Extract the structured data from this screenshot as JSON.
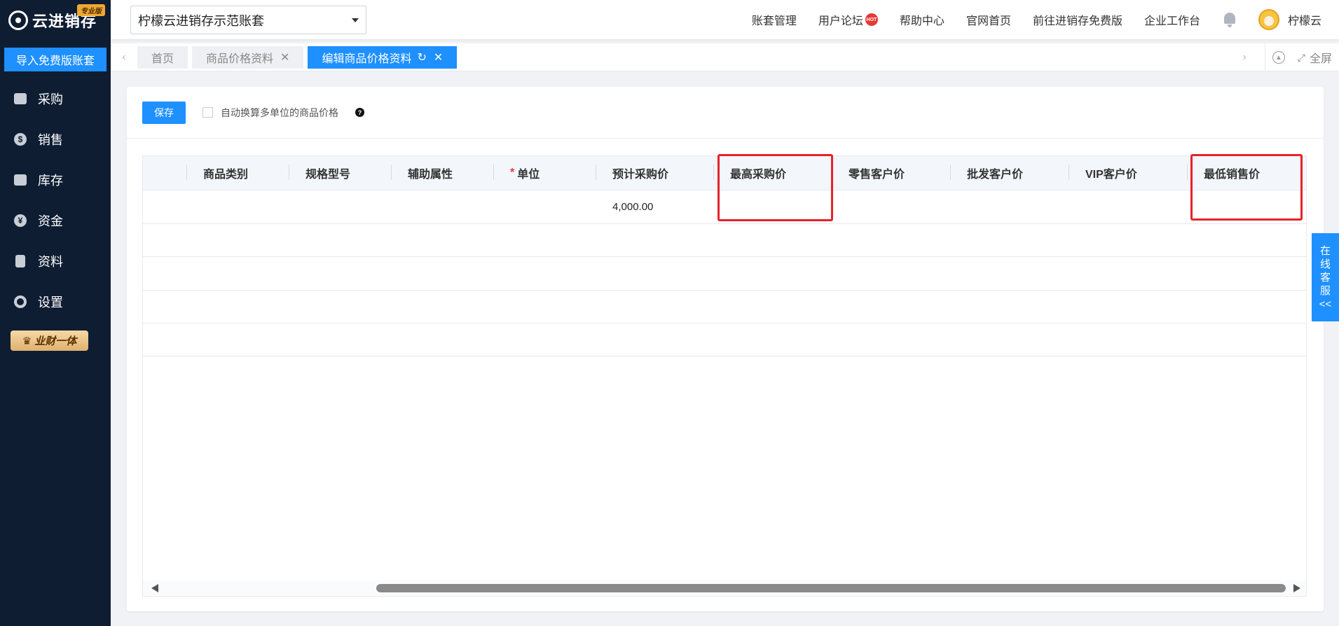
{
  "brand": {
    "logo_text": "云进销存",
    "edition_badge": "专业版"
  },
  "sidebar": {
    "import_button": "导入免费版账套",
    "items": [
      {
        "label": "采购",
        "icon": "shopping-bag-icon"
      },
      {
        "label": "销售",
        "icon": "money-bag-icon"
      },
      {
        "label": "库存",
        "icon": "warehouse-icon"
      },
      {
        "label": "资金",
        "icon": "yen-coin-icon"
      },
      {
        "label": "资料",
        "icon": "document-icon"
      },
      {
        "label": "设置",
        "icon": "gear-icon"
      }
    ],
    "promo_label": "业财一体"
  },
  "header": {
    "account_select_value": "柠檬云进销存示范账套",
    "links": {
      "account_manage": "账套管理",
      "forum": "用户论坛",
      "forum_badge": "HOT",
      "help": "帮助中心",
      "website": "官网首页",
      "free_version": "前往进销存免费版",
      "workbench": "企业工作台"
    },
    "username": "柠檬云"
  },
  "tabs": {
    "items": [
      {
        "label": "首页"
      },
      {
        "label": "商品价格资料"
      },
      {
        "label": "编辑商品价格资料"
      }
    ],
    "fullscreen_label": "全屏"
  },
  "toolbar": {
    "save_label": "保存",
    "auto_convert_label": "自动换算多单位的商品价格",
    "auto_convert_checked": false
  },
  "table": {
    "columns": [
      "商品类别",
      "规格型号",
      "辅助属性",
      "单位",
      "预计采购价",
      "最高采购价",
      "零售客户价",
      "批发客户价",
      "VIP客户价",
      "最低销售价"
    ],
    "required_mark": "*",
    "rows": [
      [
        "",
        "",
        "",
        "",
        "4,000.00",
        "",
        "",
        "",
        "",
        ""
      ],
      [
        "",
        "",
        "",
        "",
        "",
        "",
        "",
        "",
        "",
        ""
      ],
      [
        "",
        "",
        "",
        "",
        "",
        "",
        "",
        "",
        "",
        ""
      ],
      [
        "",
        "",
        "",
        "",
        "",
        "",
        "",
        "",
        "",
        ""
      ],
      [
        "",
        "",
        "",
        "",
        "",
        "",
        "",
        "",
        "",
        ""
      ]
    ],
    "highlighted_columns": [
      "最高采购价",
      "最低销售价"
    ]
  },
  "online_service": {
    "label_chars": [
      "在",
      "线",
      "客",
      "服",
      "<<"
    ]
  },
  "colors": {
    "primary": "#1e90ff",
    "sidebar_bg": "#0f1d33",
    "highlight_border": "#e8222a"
  }
}
